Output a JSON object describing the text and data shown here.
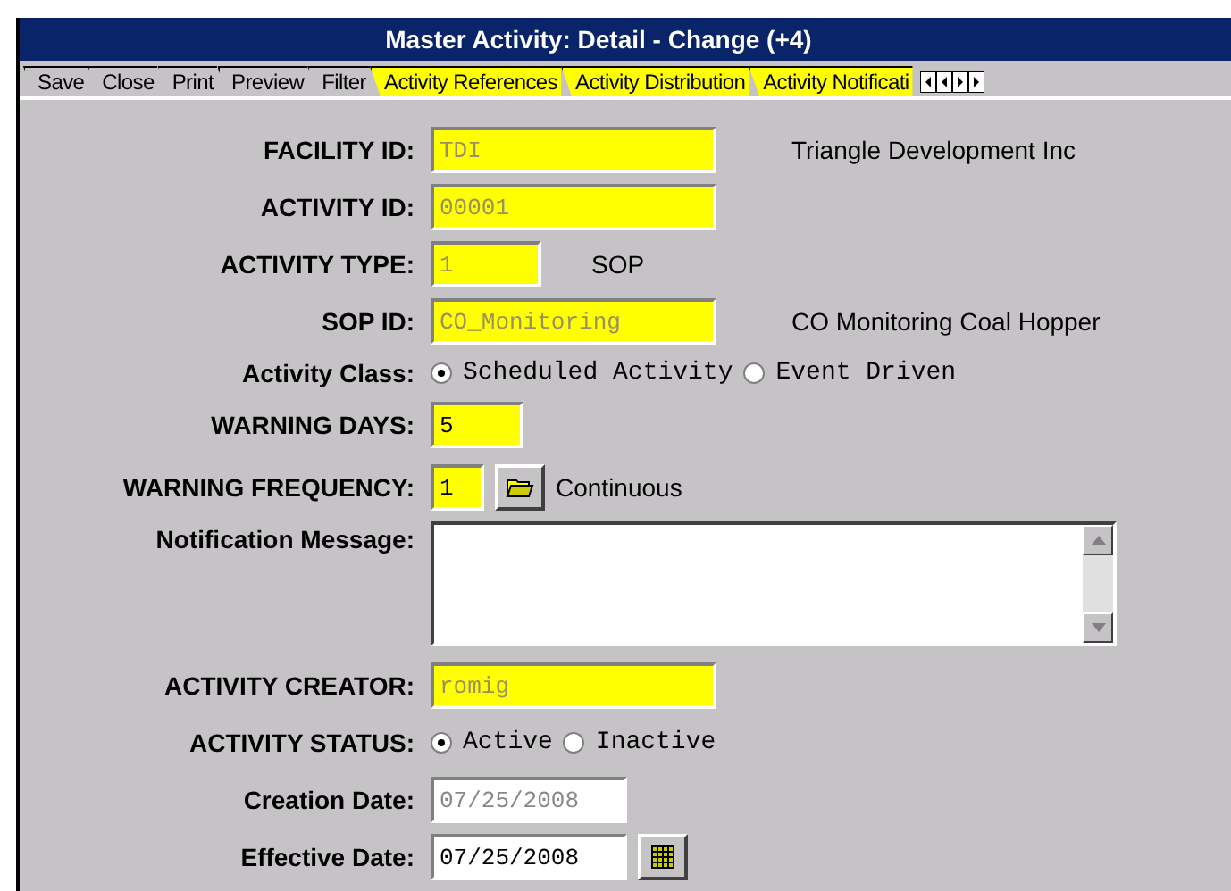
{
  "window": {
    "title": "Master Activity: Detail - Change (+4)"
  },
  "tabs": [
    {
      "label": "Save",
      "highlighted": false
    },
    {
      "label": "Close",
      "highlighted": false
    },
    {
      "label": "Print",
      "highlighted": false
    },
    {
      "label": "Preview",
      "highlighted": false
    },
    {
      "label": "Filter",
      "highlighted": false
    },
    {
      "label": "Activity  References",
      "highlighted": true
    },
    {
      "label": "Activity Distribution",
      "highlighted": true
    },
    {
      "label": "Activity Notificati",
      "highlighted": true
    }
  ],
  "rows": [
    {
      "kind": "field",
      "label": "FACILITY ID:",
      "value": "TDI",
      "highlighted": true,
      "disabled": true,
      "note": "Triangle Development Inc"
    },
    {
      "kind": "field",
      "label": "ACTIVITY ID:",
      "value": "00001",
      "highlighted": true,
      "disabled": true
    },
    {
      "kind": "field",
      "label": "ACTIVITY TYPE:",
      "value": "1",
      "highlighted": true,
      "disabled": true,
      "note": "SOP"
    },
    {
      "kind": "field",
      "label": "SOP ID:",
      "value": "CO_Monitoring",
      "highlighted": true,
      "disabled": true,
      "note": "CO Monitoring Coal Hopper"
    },
    {
      "kind": "radio",
      "label": "Activity Class:",
      "options": [
        {
          "label": "Scheduled Activity",
          "selected": true
        },
        {
          "label": "Event Driven",
          "selected": false
        }
      ]
    },
    {
      "kind": "field",
      "label": "WARNING DAYS:",
      "value": "5",
      "highlighted": true,
      "disabled": false
    },
    {
      "kind": "field",
      "label": "WARNING FREQUENCY:",
      "value": "1",
      "highlighted": true,
      "disabled": false,
      "lookup_button": true,
      "note": "Continuous"
    },
    {
      "kind": "memo",
      "label": "Notification Message:"
    },
    {
      "kind": "field",
      "label": "ACTIVITY CREATOR:",
      "value": "romig",
      "highlighted": true,
      "disabled": true
    },
    {
      "kind": "radio",
      "label": "ACTIVITY STATUS:",
      "options": [
        {
          "label": "Active",
          "selected": true
        },
        {
          "label": "Inactive",
          "selected": false
        }
      ]
    },
    {
      "kind": "field",
      "label": "Creation Date:",
      "value": "07/25/2008",
      "highlighted": false,
      "disabled": true
    },
    {
      "kind": "field",
      "label": "Effective Date:",
      "value": "07/25/2008",
      "highlighted": false,
      "disabled": false,
      "calendar_button": true
    }
  ]
}
